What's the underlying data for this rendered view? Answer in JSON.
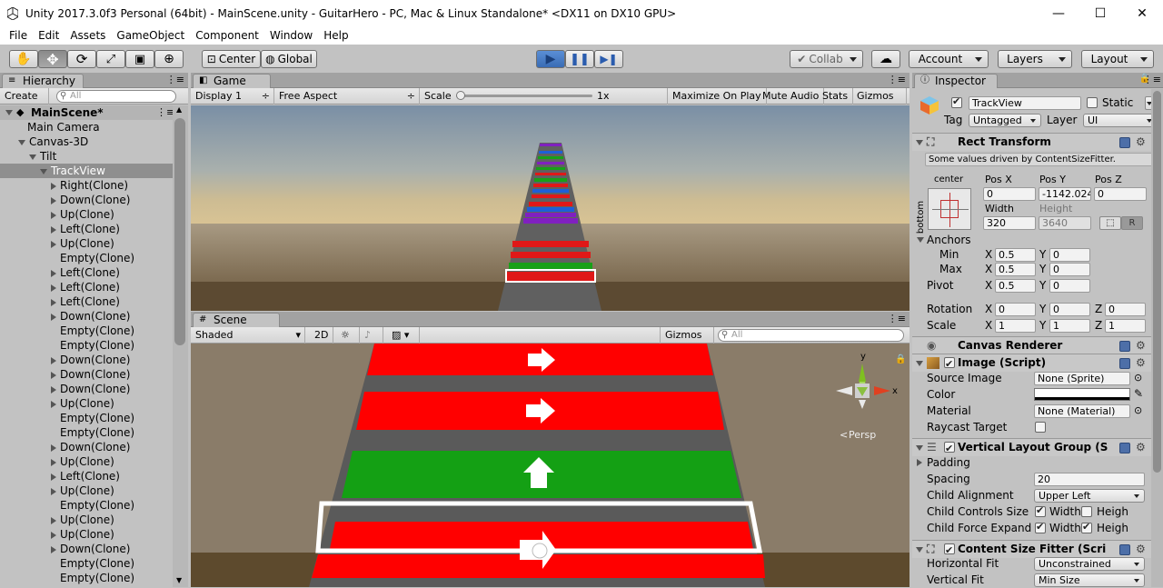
{
  "window": {
    "title": "Unity 2017.3.0f3 Personal (64bit) - MainScene.unity - GuitarHero - PC, Mac & Linux Standalone* <DX11 on DX10 GPU>"
  },
  "menu": [
    "File",
    "Edit",
    "Assets",
    "GameObject",
    "Component",
    "Window",
    "Help"
  ],
  "toolbar": {
    "pivot_label": "Center",
    "space_label": "Global",
    "collab_label": "Collab",
    "account_label": "Account",
    "layers_label": "Layers",
    "layout_label": "Layout"
  },
  "hierarchy": {
    "tab_label": "Hierarchy",
    "create_label": "Create",
    "search_placeholder": "All",
    "scene_name": "MainScene*",
    "rows": [
      {
        "label": "Main Camera",
        "indent": 1,
        "arrow": "none"
      },
      {
        "label": "Canvas-3D",
        "indent": 1,
        "arrow": "open"
      },
      {
        "label": "Tilt",
        "indent": 2,
        "arrow": "open"
      },
      {
        "label": "TrackView",
        "indent": 3,
        "arrow": "open",
        "selected": true
      },
      {
        "label": "Right(Clone)",
        "indent": 4,
        "arrow": "closed"
      },
      {
        "label": "Down(Clone)",
        "indent": 4,
        "arrow": "closed"
      },
      {
        "label": "Up(Clone)",
        "indent": 4,
        "arrow": "closed"
      },
      {
        "label": "Left(Clone)",
        "indent": 4,
        "arrow": "closed"
      },
      {
        "label": "Up(Clone)",
        "indent": 4,
        "arrow": "closed"
      },
      {
        "label": "Empty(Clone)",
        "indent": 4,
        "arrow": "none"
      },
      {
        "label": "Left(Clone)",
        "indent": 4,
        "arrow": "closed"
      },
      {
        "label": "Left(Clone)",
        "indent": 4,
        "arrow": "closed"
      },
      {
        "label": "Left(Clone)",
        "indent": 4,
        "arrow": "closed"
      },
      {
        "label": "Down(Clone)",
        "indent": 4,
        "arrow": "closed"
      },
      {
        "label": "Empty(Clone)",
        "indent": 4,
        "arrow": "none"
      },
      {
        "label": "Empty(Clone)",
        "indent": 4,
        "arrow": "none"
      },
      {
        "label": "Down(Clone)",
        "indent": 4,
        "arrow": "closed"
      },
      {
        "label": "Down(Clone)",
        "indent": 4,
        "arrow": "closed"
      },
      {
        "label": "Down(Clone)",
        "indent": 4,
        "arrow": "closed"
      },
      {
        "label": "Up(Clone)",
        "indent": 4,
        "arrow": "closed"
      },
      {
        "label": "Empty(Clone)",
        "indent": 4,
        "arrow": "none"
      },
      {
        "label": "Empty(Clone)",
        "indent": 4,
        "arrow": "none"
      },
      {
        "label": "Down(Clone)",
        "indent": 4,
        "arrow": "closed"
      },
      {
        "label": "Up(Clone)",
        "indent": 4,
        "arrow": "closed"
      },
      {
        "label": "Left(Clone)",
        "indent": 4,
        "arrow": "closed"
      },
      {
        "label": "Up(Clone)",
        "indent": 4,
        "arrow": "closed"
      },
      {
        "label": "Empty(Clone)",
        "indent": 4,
        "arrow": "none"
      },
      {
        "label": "Up(Clone)",
        "indent": 4,
        "arrow": "closed"
      },
      {
        "label": "Up(Clone)",
        "indent": 4,
        "arrow": "closed"
      },
      {
        "label": "Down(Clone)",
        "indent": 4,
        "arrow": "closed"
      },
      {
        "label": "Empty(Clone)",
        "indent": 4,
        "arrow": "none"
      },
      {
        "label": "Empty(Clone)",
        "indent": 4,
        "arrow": "none"
      }
    ]
  },
  "game": {
    "tab_label": "Game",
    "display_label": "Display 1",
    "aspect_label": "Free Aspect",
    "scale_label": "Scale",
    "scale_value": "1x",
    "maximize_label": "Maximize On Play",
    "mute_label": "Mute Audio",
    "stats_label": "Stats",
    "gizmos_label": "Gizmos"
  },
  "scene": {
    "tab_label": "Scene",
    "shading_label": "Shaded",
    "mode_2d_label": "2D",
    "gizmos_label": "Gizmos",
    "search_placeholder": "All",
    "persp_label": "Persp",
    "axis_y": "y",
    "axis_x": "x"
  },
  "inspector": {
    "tab_label": "Inspector",
    "object_name": "TrackView",
    "static_label": "Static",
    "tag_label": "Tag",
    "tag_value": "Untagged",
    "layer_label": "Layer",
    "layer_value": "UI",
    "rect_transform": {
      "title": "Rect Transform",
      "note": "Some values driven by ContentSizeFitter.",
      "anchor_top_label": "center",
      "anchor_side_label": "bottom",
      "pos_x_label": "Pos X",
      "pos_y_label": "Pos Y",
      "pos_z_label": "Pos Z",
      "pos_x": "0",
      "pos_y": "-1142.024",
      "pos_z": "0",
      "width_label": "Width",
      "height_label": "Height",
      "width": "320",
      "height": "3640",
      "r_label": "R",
      "anchors_label": "Anchors",
      "min_label": "Min",
      "max_label": "Max",
      "min_x": "0.5",
      "min_y": "0",
      "max_x": "0.5",
      "max_y": "0",
      "pivot_label": "Pivot",
      "pivot_x": "0.5",
      "pivot_y": "0",
      "rotation_label": "Rotation",
      "rot_x": "0",
      "rot_y": "0",
      "rot_z": "0",
      "scale_label": "Scale",
      "scale_x": "1",
      "scale_y": "1",
      "scale_z": "1",
      "x": "X",
      "y": "Y",
      "z": "Z"
    },
    "canvas_renderer": {
      "title": "Canvas Renderer"
    },
    "image": {
      "title": "Image (Script)",
      "source_label": "Source Image",
      "source_value": "None (Sprite)",
      "color_label": "Color",
      "material_label": "Material",
      "material_value": "None (Material)",
      "raycast_label": "Raycast Target"
    },
    "vlg": {
      "title": "Vertical Layout Group (S",
      "padding_label": "Padding",
      "spacing_label": "Spacing",
      "spacing_value": "20",
      "alignment_label": "Child Alignment",
      "alignment_value": "Upper Left",
      "controls_label": "Child Controls Size",
      "expand_label": "Child Force Expand",
      "width_label": "Width",
      "height_label": "Heigh"
    },
    "csf": {
      "title": "Content Size Fitter (Scri",
      "hfit_label": "Horizontal Fit",
      "hfit_value": "Unconstrained",
      "vfit_label": "Vertical Fit",
      "vfit_value": "Min Size"
    }
  }
}
